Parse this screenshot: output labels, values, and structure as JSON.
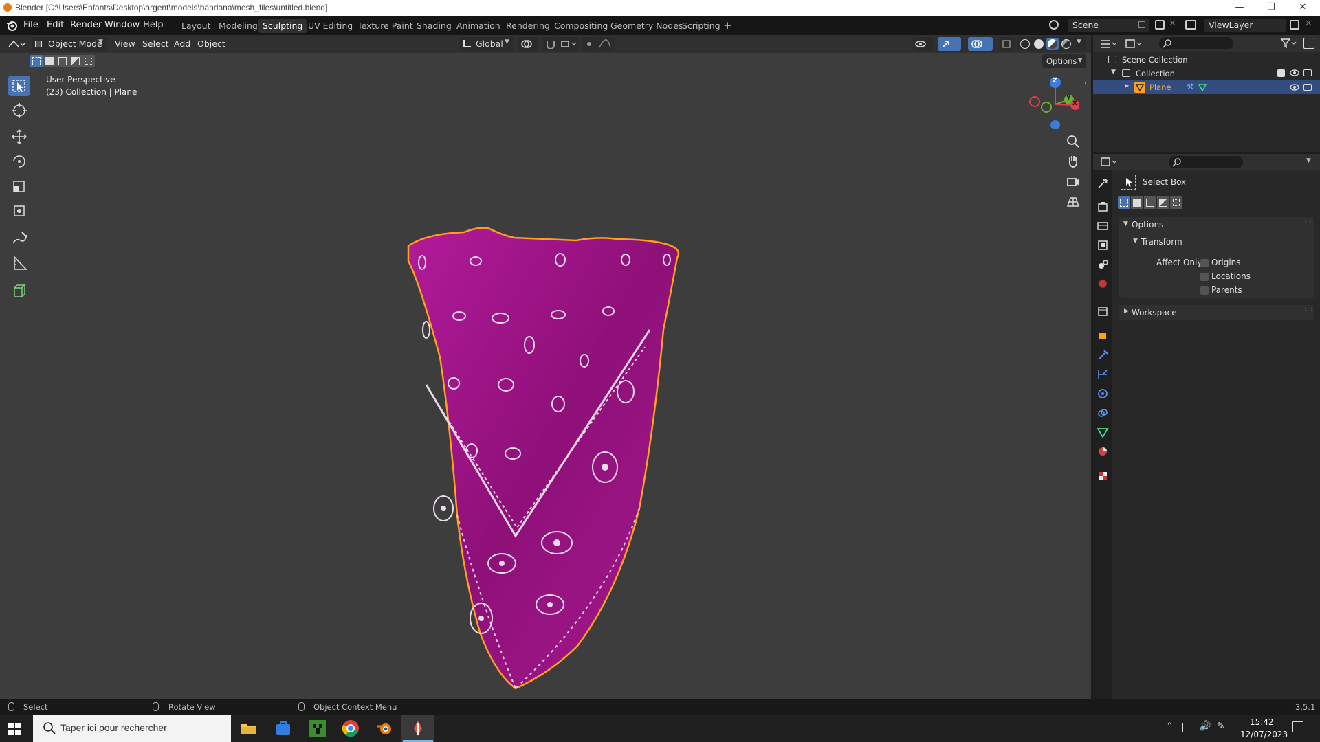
{
  "window": {
    "title": "Blender [C:\\Users\\Enfants\\Desktop\\argent\\models\\bandana\\mesh_files\\untitled.blend]"
  },
  "menu": [
    "File",
    "Edit",
    "Render",
    "Window",
    "Help"
  ],
  "workspaces": [
    "Layout",
    "Modeling",
    "Sculpting",
    "UV Editing",
    "Texture Paint",
    "Shading",
    "Animation",
    "Rendering",
    "Compositing",
    "Geometry Nodes",
    "Scripting"
  ],
  "active_workspace": "Sculpting",
  "scene": {
    "name": "Scene",
    "view_layer": "ViewLayer"
  },
  "viewport_header": {
    "mode": "Object Mode",
    "menus": [
      "View",
      "Select",
      "Add",
      "Object"
    ],
    "orientation": "Global",
    "options_label": "Options"
  },
  "viewport_overlay": {
    "perspective": "User Perspective",
    "collection_info": "(23) Collection | Plane"
  },
  "gizmo_axes": {
    "z": "Z",
    "y": "Y",
    "x": "X"
  },
  "outliner": {
    "root": "Scene Collection",
    "collection": "Collection",
    "object": "Plane"
  },
  "properties": {
    "tool_name": "Select Box",
    "options_label": "Options",
    "transform_label": "Transform",
    "affect_only_label": "Affect Only",
    "affect_only": [
      "Origins",
      "Locations",
      "Parents"
    ],
    "workspace_label": "Workspace"
  },
  "statusbar": {
    "select": "Select",
    "rotate": "Rotate View",
    "context": "Object Context Menu",
    "version": "3.5.1"
  },
  "taskbar": {
    "search_placeholder": "Taper ici pour rechercher",
    "time": "15:42",
    "date": "12/07/2023"
  },
  "colors": {
    "accent": "#4772b3",
    "bandana": "#9b1485",
    "outline": "#ff9f1c",
    "viewport_bg": "#3d3d3d"
  }
}
